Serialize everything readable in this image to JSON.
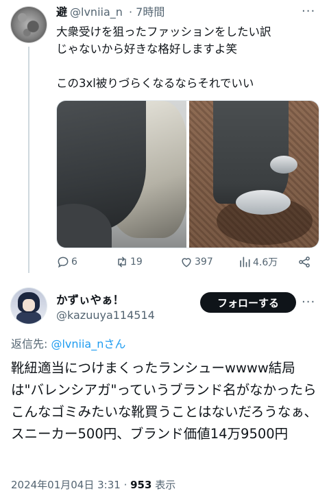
{
  "post1": {
    "display_name": "避",
    "handle": "@lvniia_n",
    "time": "· 7時間",
    "text_lines": [
      "大衆受けを狙ったファッションをしたい訳",
      "じゃないから好きな格好しますよ笑",
      "",
      "この3xl被りづらくなるならそれでいい"
    ],
    "more_icon": "more-horizontal-icon",
    "actions": {
      "reply_count": "6",
      "repost_count": "19",
      "like_count": "397",
      "views_count": "4.6万"
    }
  },
  "post2": {
    "display_name": "かずぃやぁ！",
    "handle": "@kazuuya114514",
    "follow_label": "フォローする",
    "reply_prefix": "返信先: ",
    "reply_mention": "@lvniia_nさん",
    "text": "靴紐適当につけまくったランシューwwww結局は\"バレンシアガ\"っていうブランド名がなかったらこんなゴミみたいな靴買うことはないだろうなぁ、スニーカー500円、ブランド価値14万9500円",
    "date": "2024年01月04日 3:31 · ",
    "views": "953",
    "views_label": " 表示"
  },
  "colors": {
    "accent": "#1d9bf0",
    "secondary_text": "#536471",
    "primary_text": "#0f1419"
  }
}
